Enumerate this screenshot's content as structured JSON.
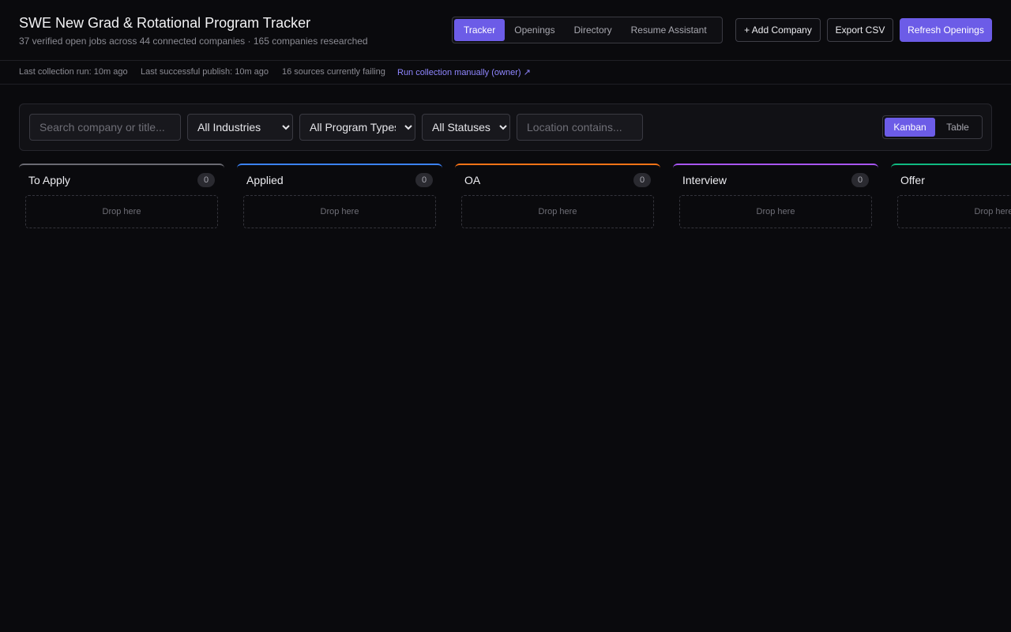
{
  "header": {
    "title": "SWE New Grad & Rotational Program Tracker",
    "subtitle": "37 verified open jobs across 44 connected companies · 165 companies researched",
    "tabs": [
      "Tracker",
      "Openings",
      "Directory",
      "Resume Assistant"
    ],
    "active_tab": "Tracker",
    "add_company_label": "+ Add Company",
    "export_label": "Export CSV",
    "refresh_label": "Refresh Openings"
  },
  "status": {
    "last_run": "Last collection run: 10m ago",
    "last_publish": "Last successful publish: 10m ago",
    "failing": "16 sources currently failing",
    "manual_link": "Run collection manually (owner) ↗"
  },
  "filters": {
    "search_placeholder": "Search company or title...",
    "industry": "All Industries",
    "program_type": "All Program Types",
    "status": "All Statuses",
    "location_placeholder": "Location contains...",
    "view_options": [
      "Kanban",
      "Table"
    ],
    "active_view": "Kanban"
  },
  "board": {
    "drop_label": "Drop here",
    "columns": [
      {
        "name": "To Apply",
        "count": "0",
        "color": "#6b6b73"
      },
      {
        "name": "Applied",
        "count": "0",
        "color": "#3b82f6"
      },
      {
        "name": "OA",
        "count": "0",
        "color": "#f97316"
      },
      {
        "name": "Interview",
        "count": "0",
        "color": "#a855f7"
      },
      {
        "name": "Offer",
        "count": "0",
        "color": "#10b981"
      }
    ]
  },
  "colors": {
    "accent": "#6c5ce7",
    "background": "#0a0a0d",
    "link": "#8f86ff"
  }
}
